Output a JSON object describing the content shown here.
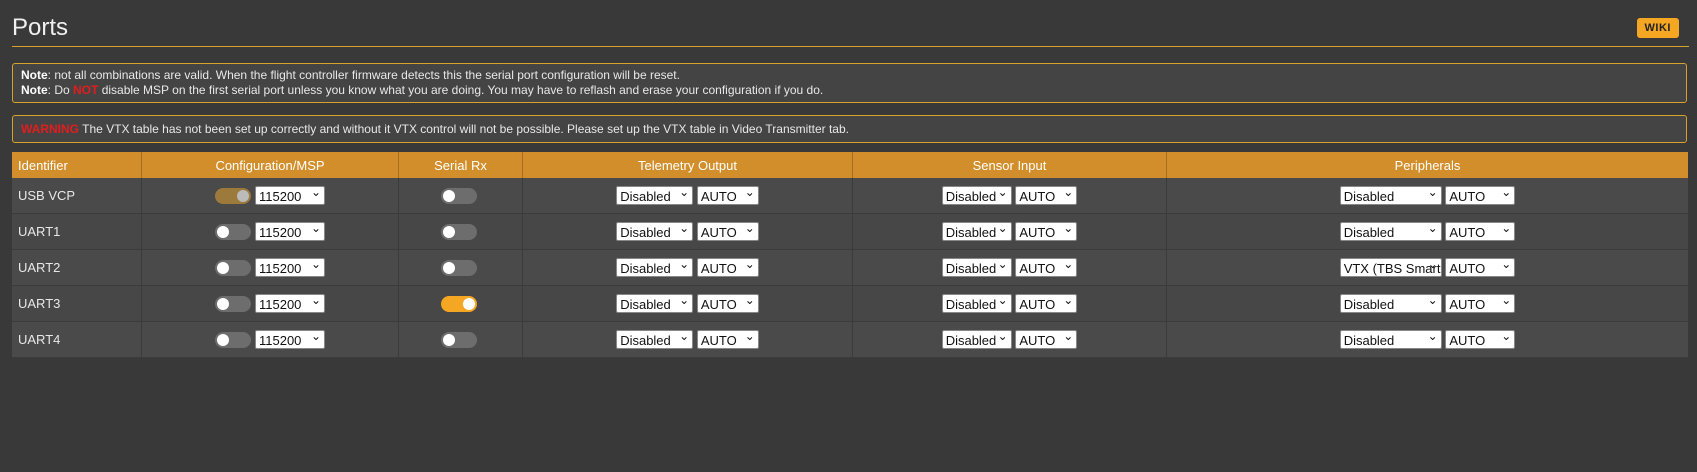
{
  "header": {
    "title": "Ports",
    "wiki_label": "WIKI"
  },
  "note": {
    "line1_label": "Note",
    "line1_text": ": not all combinations are valid. When the flight controller firmware detects this the serial port configuration will be reset.",
    "line2_label": "Note",
    "line2_pre": ": Do ",
    "line2_not": "NOT",
    "line2_post": " disable MSP on the first serial port unless you know what you are doing. You may have to reflash and erase your configuration if you do."
  },
  "warning": {
    "label": "WARNING",
    "text": " The VTX table has not been set up correctly and without it VTX control will not be possible. Please set up the VTX table in Video Transmitter tab."
  },
  "table": {
    "headers": [
      "Identifier",
      "Configuration/MSP",
      "Serial Rx",
      "Telemetry Output",
      "Sensor Input",
      "Peripherals"
    ],
    "rows": [
      {
        "id": "USB VCP",
        "msp": true,
        "msp_locked": true,
        "baud": "115200",
        "serial_rx": false,
        "telemetry": "Disabled",
        "telemetry_baud": "AUTO",
        "sensor": "Disabled",
        "sensor_baud": "AUTO",
        "peripheral": "Disabled",
        "peripheral_baud": "AUTO"
      },
      {
        "id": "UART1",
        "msp": false,
        "baud": "115200",
        "serial_rx": false,
        "telemetry": "Disabled",
        "telemetry_baud": "AUTO",
        "sensor": "Disabled",
        "sensor_baud": "AUTO",
        "peripheral": "Disabled",
        "peripheral_baud": "AUTO"
      },
      {
        "id": "UART2",
        "msp": false,
        "baud": "115200",
        "serial_rx": false,
        "telemetry": "Disabled",
        "telemetry_baud": "AUTO",
        "sensor": "Disabled",
        "sensor_baud": "AUTO",
        "peripheral": "VTX (TBS Smart",
        "peripheral_baud": "AUTO"
      },
      {
        "id": "UART3",
        "msp": false,
        "baud": "115200",
        "serial_rx": true,
        "telemetry": "Disabled",
        "telemetry_baud": "AUTO",
        "sensor": "Disabled",
        "sensor_baud": "AUTO",
        "peripheral": "Disabled",
        "peripheral_baud": "AUTO"
      },
      {
        "id": "UART4",
        "msp": false,
        "baud": "115200",
        "serial_rx": false,
        "telemetry": "Disabled",
        "telemetry_baud": "AUTO",
        "sensor": "Disabled",
        "sensor_baud": "AUTO",
        "peripheral": "Disabled",
        "peripheral_baud": "AUTO"
      }
    ]
  },
  "colors": {
    "accent": "#f5a623",
    "header_bar": "#d28e2a",
    "warning_red": "#e21d1d",
    "background": "#393939"
  }
}
